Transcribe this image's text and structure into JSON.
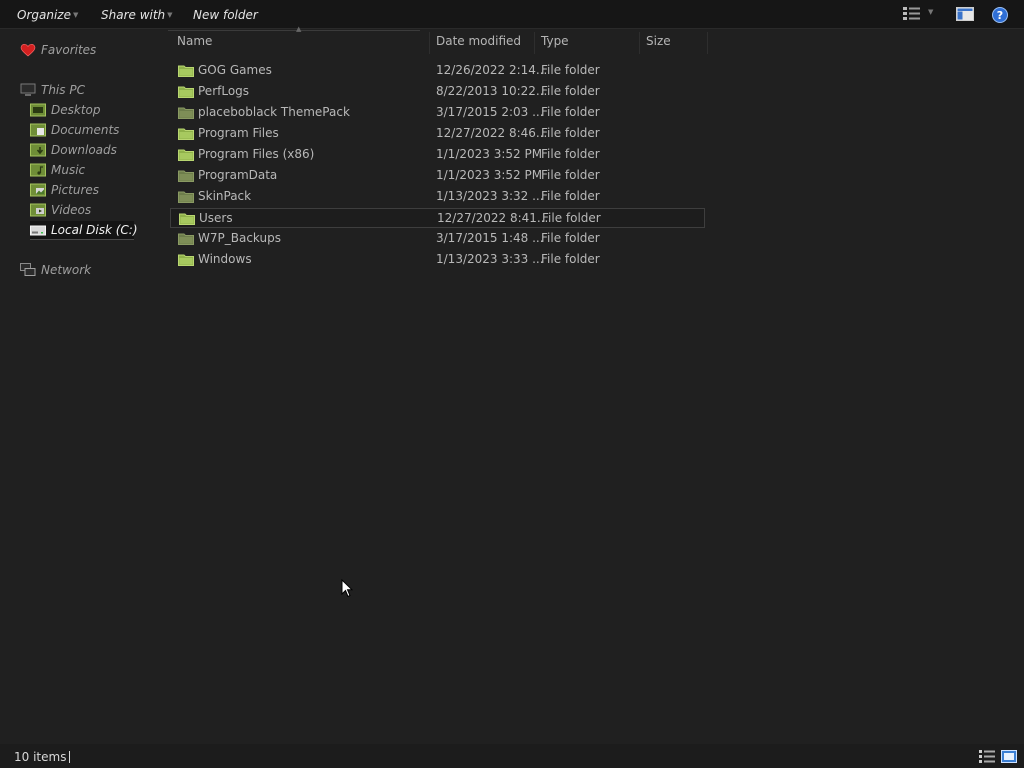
{
  "toolbar": {
    "organize_label": "Organize",
    "share_label": "Share with",
    "new_folder_label": "New folder"
  },
  "nav": {
    "favorites": "Favorites",
    "this_pc": "This PC",
    "items": [
      {
        "label": "Desktop",
        "icon": "desktop-icon"
      },
      {
        "label": "Documents",
        "icon": "documents-icon"
      },
      {
        "label": "Downloads",
        "icon": "downloads-icon"
      },
      {
        "label": "Music",
        "icon": "music-icon"
      },
      {
        "label": "Pictures",
        "icon": "pictures-icon"
      },
      {
        "label": "Videos",
        "icon": "videos-icon"
      },
      {
        "label": "Local Disk (C:)",
        "icon": "drive-icon"
      }
    ],
    "network": "Network"
  },
  "columns": {
    "name": "Name",
    "date": "Date modified",
    "type": "Type",
    "size": "Size"
  },
  "files": [
    {
      "name": "GOG Games",
      "date": "12/26/2022 2:14...",
      "type": "File folder",
      "size": ""
    },
    {
      "name": "PerfLogs",
      "date": "8/22/2013 10:22...",
      "type": "File folder",
      "size": ""
    },
    {
      "name": "placeboblack ThemePack",
      "date": "3/17/2015 2:03 ...",
      "type": "File folder",
      "size": ""
    },
    {
      "name": "Program Files",
      "date": "12/27/2022 8:46...",
      "type": "File folder",
      "size": ""
    },
    {
      "name": "Program Files (x86)",
      "date": "1/1/2023 3:52 PM",
      "type": "File folder",
      "size": ""
    },
    {
      "name": "ProgramData",
      "date": "1/1/2023 3:52 PM",
      "type": "File folder",
      "size": ""
    },
    {
      "name": "SkinPack",
      "date": "1/13/2023 3:32 ...",
      "type": "File folder",
      "size": ""
    },
    {
      "name": "Users",
      "date": "12/27/2022 8:41...",
      "type": "File folder",
      "size": ""
    },
    {
      "name": "W7P_Backups",
      "date": "3/17/2015 1:48 ...",
      "type": "File folder",
      "size": ""
    },
    {
      "name": "Windows",
      "date": "1/13/2023 3:33 ...",
      "type": "File folder",
      "size": ""
    }
  ],
  "status": {
    "item_count": "10 items"
  },
  "colors": {
    "background": "#202020",
    "toolbar": "#161616",
    "folder_green": "#8fb14a",
    "favorites_heart": "#d32020",
    "help_blue": "#2f6fd6"
  }
}
